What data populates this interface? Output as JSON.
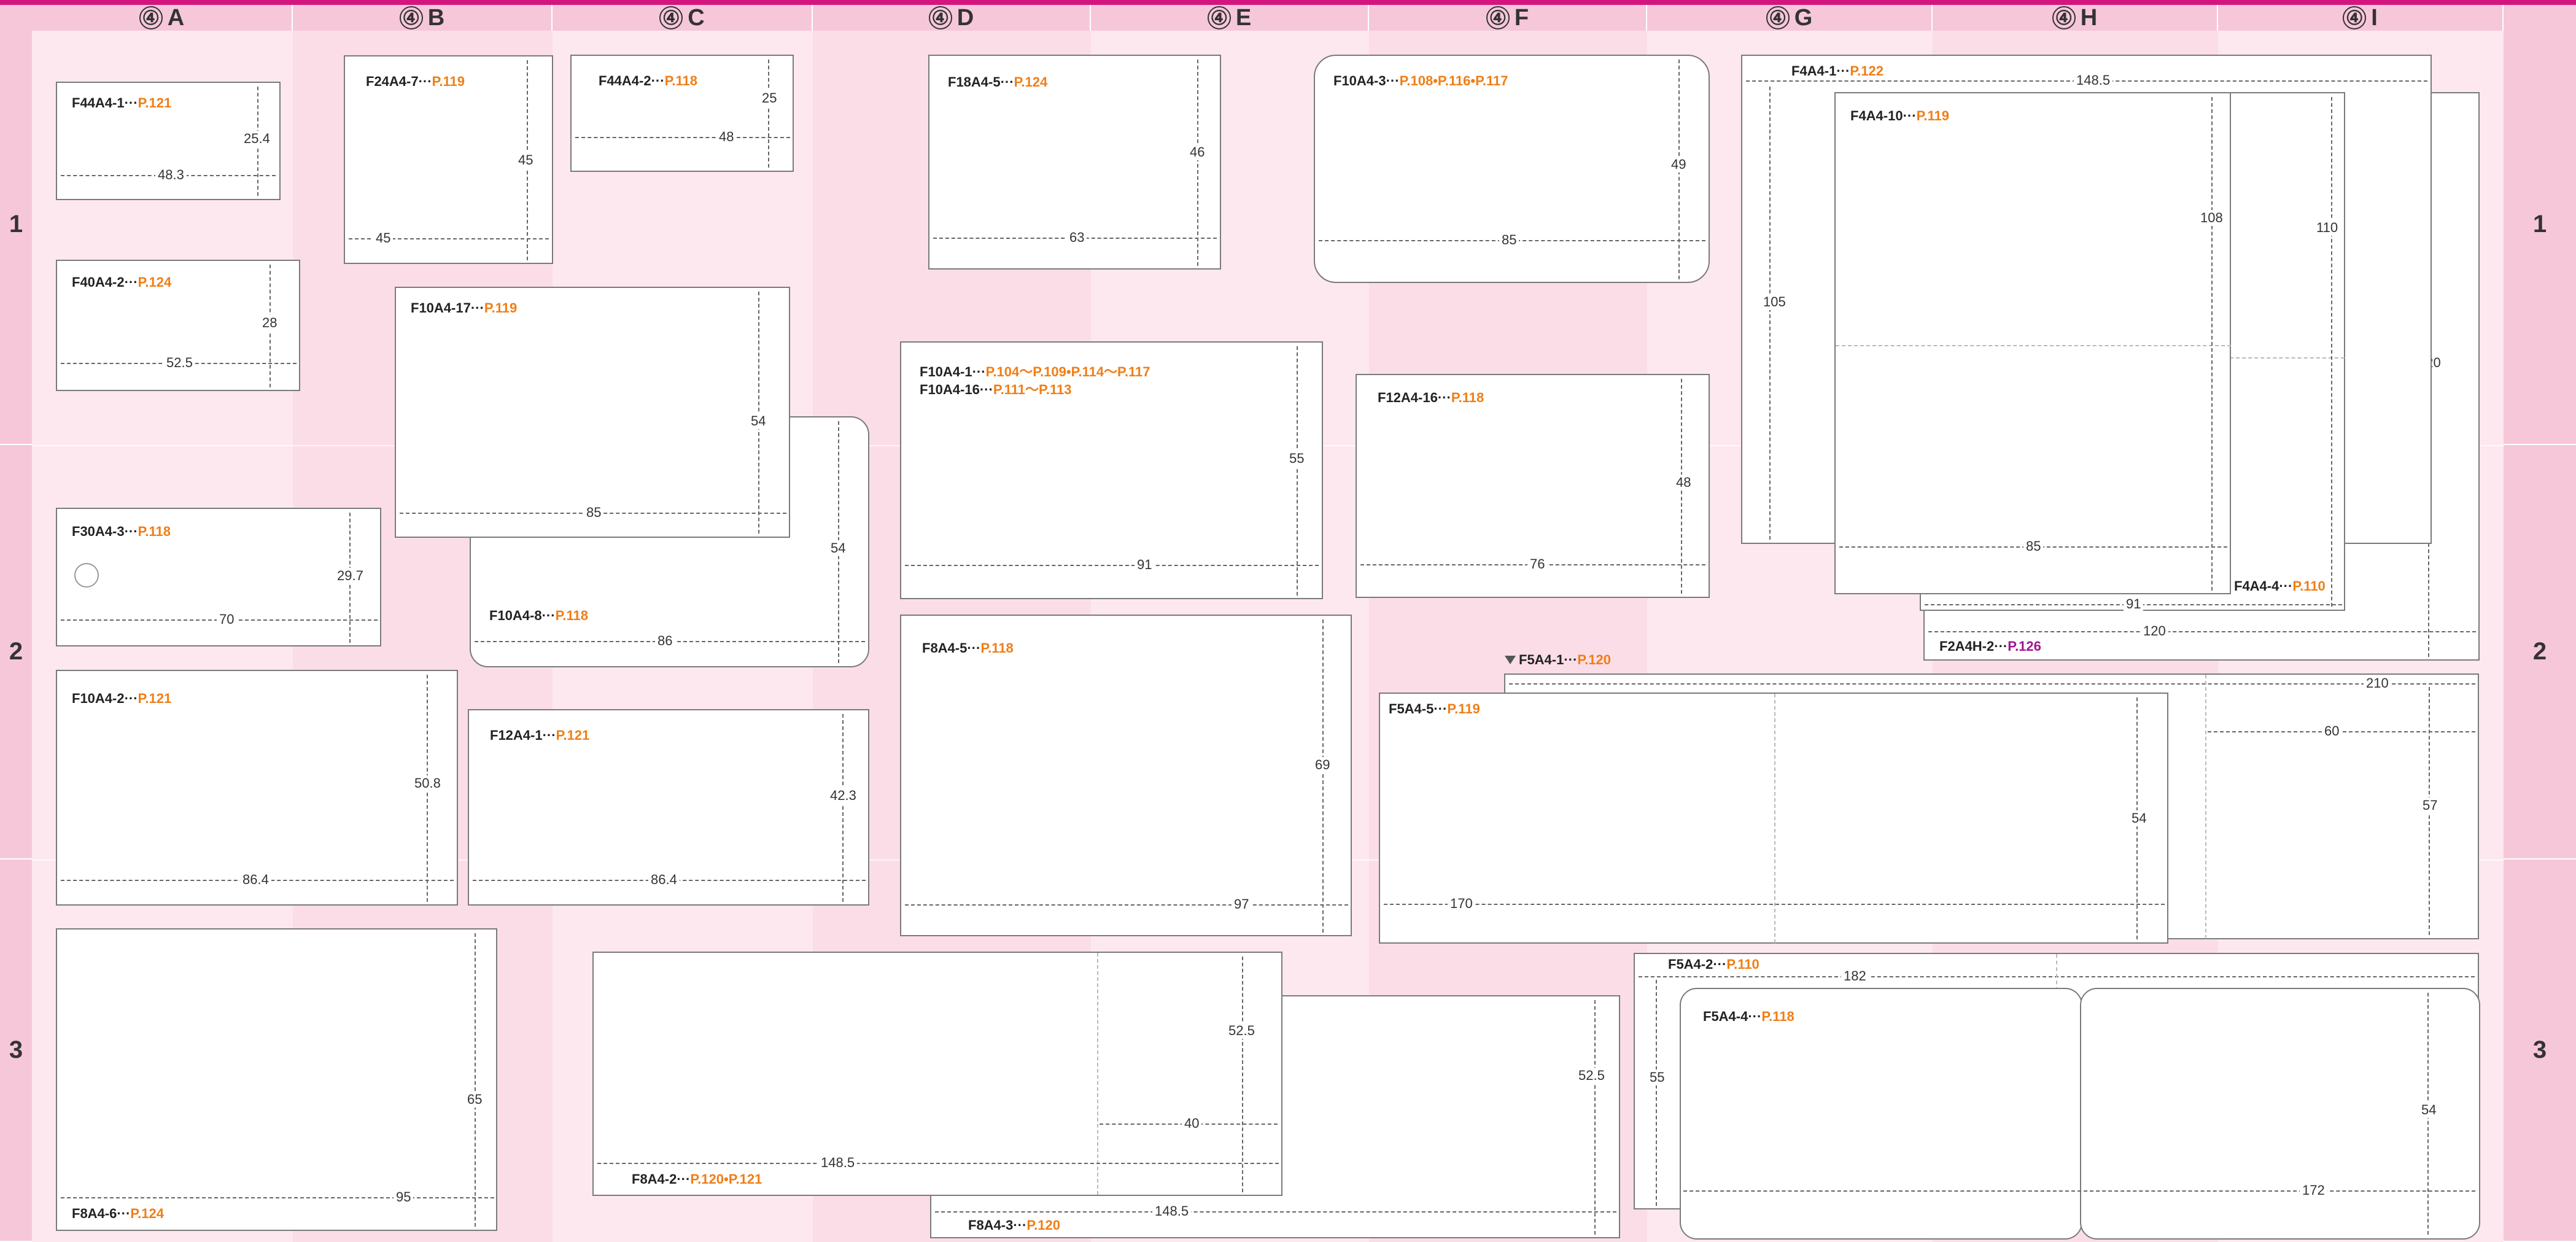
{
  "columns": [
    "④A",
    "④B",
    "④C",
    "④D",
    "④E",
    "④F",
    "④G",
    "④H",
    "④I"
  ],
  "column_letters": [
    "A",
    "B",
    "C",
    "D",
    "E",
    "F",
    "G",
    "H",
    "I"
  ],
  "column_circle": "④",
  "rows": [
    "1",
    "2",
    "3"
  ],
  "panels": {
    "F44A4_1": {
      "code": "F44A4-1···",
      "page": "P.121",
      "w": "48.3",
      "h": "25.4"
    },
    "F40A4_2": {
      "code": "F40A4-2···",
      "page": "P.124",
      "w": "52.5",
      "h": "28"
    },
    "F24A4_7": {
      "code": "F24A4-7···",
      "page": "P.119",
      "w": "45",
      "h": "45"
    },
    "F44A4_2": {
      "code": "F44A4-2···",
      "page": "P.118",
      "w": "48",
      "h": "25"
    },
    "F10A4_17": {
      "code": "F10A4-17···",
      "page": "P.119",
      "w": "85",
      "h": "54"
    },
    "F10A4_8": {
      "code": "F10A4-8···",
      "page": "P.118",
      "w": "86",
      "h": "54"
    },
    "F30A4_3": {
      "code": "F30A4-3···",
      "page": "P.118",
      "w": "70",
      "h": "29.7"
    },
    "F10A4_2": {
      "code": "F10A4-2···",
      "page": "P.121",
      "w": "86.4",
      "h": "50.8"
    },
    "F12A4_1": {
      "code": "F12A4-1···",
      "page": "P.121",
      "w": "86.4",
      "h": "42.3"
    },
    "F8A4_6": {
      "code": "F8A4-6···",
      "page": "P.124",
      "w": "95",
      "h": "65"
    },
    "F18A4_5": {
      "code": "F18A4-5···",
      "page": "P.124",
      "w": "63",
      "h": "46"
    },
    "F10A4_1": {
      "code": "F10A4-1···",
      "page": "P.104～P.109•P.114～P.117",
      "w": "91",
      "h": "55"
    },
    "F10A4_16": {
      "code": "F10A4-16···",
      "page": "P.111～P.113"
    },
    "F8A4_5": {
      "code": "F8A4-5···",
      "page": "P.118",
      "w": "97",
      "h": "69"
    },
    "F8A4_2": {
      "code": "F8A4-2···",
      "page": "P.120•P.121",
      "w": "148.5",
      "h": "52.5",
      "inner": "40"
    },
    "F8A4_3": {
      "code": "F8A4-3···",
      "page": "P.120",
      "w": "148.5",
      "h": "52.5"
    },
    "F10A4_3": {
      "code": "F10A4-3···",
      "page": "P.108•P.116•P.117",
      "w": "85",
      "h": "49"
    },
    "F12A4_16": {
      "code": "F12A4-16···",
      "page": "P.118",
      "w": "76",
      "h": "48"
    },
    "F5A4_1": {
      "code": "F5A4-1···",
      "page": "P.120",
      "w": "210",
      "h": "57",
      "side": "60"
    },
    "F5A4_5": {
      "code": "F5A4-5···",
      "page": "P.119",
      "w": "170",
      "h": "54"
    },
    "F4A4_1": {
      "code": "F4A4-1···",
      "page": "P.122",
      "w": "148.5",
      "h": "105"
    },
    "F4A4_10": {
      "code": "F4A4-10···",
      "page": "P.119",
      "w": "85",
      "h": "108"
    },
    "F4A4_4": {
      "code": "F4A4-4···",
      "page": "P.110",
      "w": "91",
      "h": "110"
    },
    "F2A4H_2": {
      "code": "F2A4H-2···",
      "page": "P.126",
      "w": "120",
      "h": "120"
    },
    "F5A4_2": {
      "code": "F5A4-2···",
      "page": "P.110",
      "w": "182",
      "h": "55"
    },
    "F5A4_4": {
      "code": "F5A4-4···",
      "page": "P.118",
      "w": "172",
      "h": "54"
    }
  },
  "colors": {
    "accent": "#d4157f",
    "header": "#f6c7d9",
    "page_ref": "#f07e16",
    "page_ref_alt": "#a0168e"
  }
}
